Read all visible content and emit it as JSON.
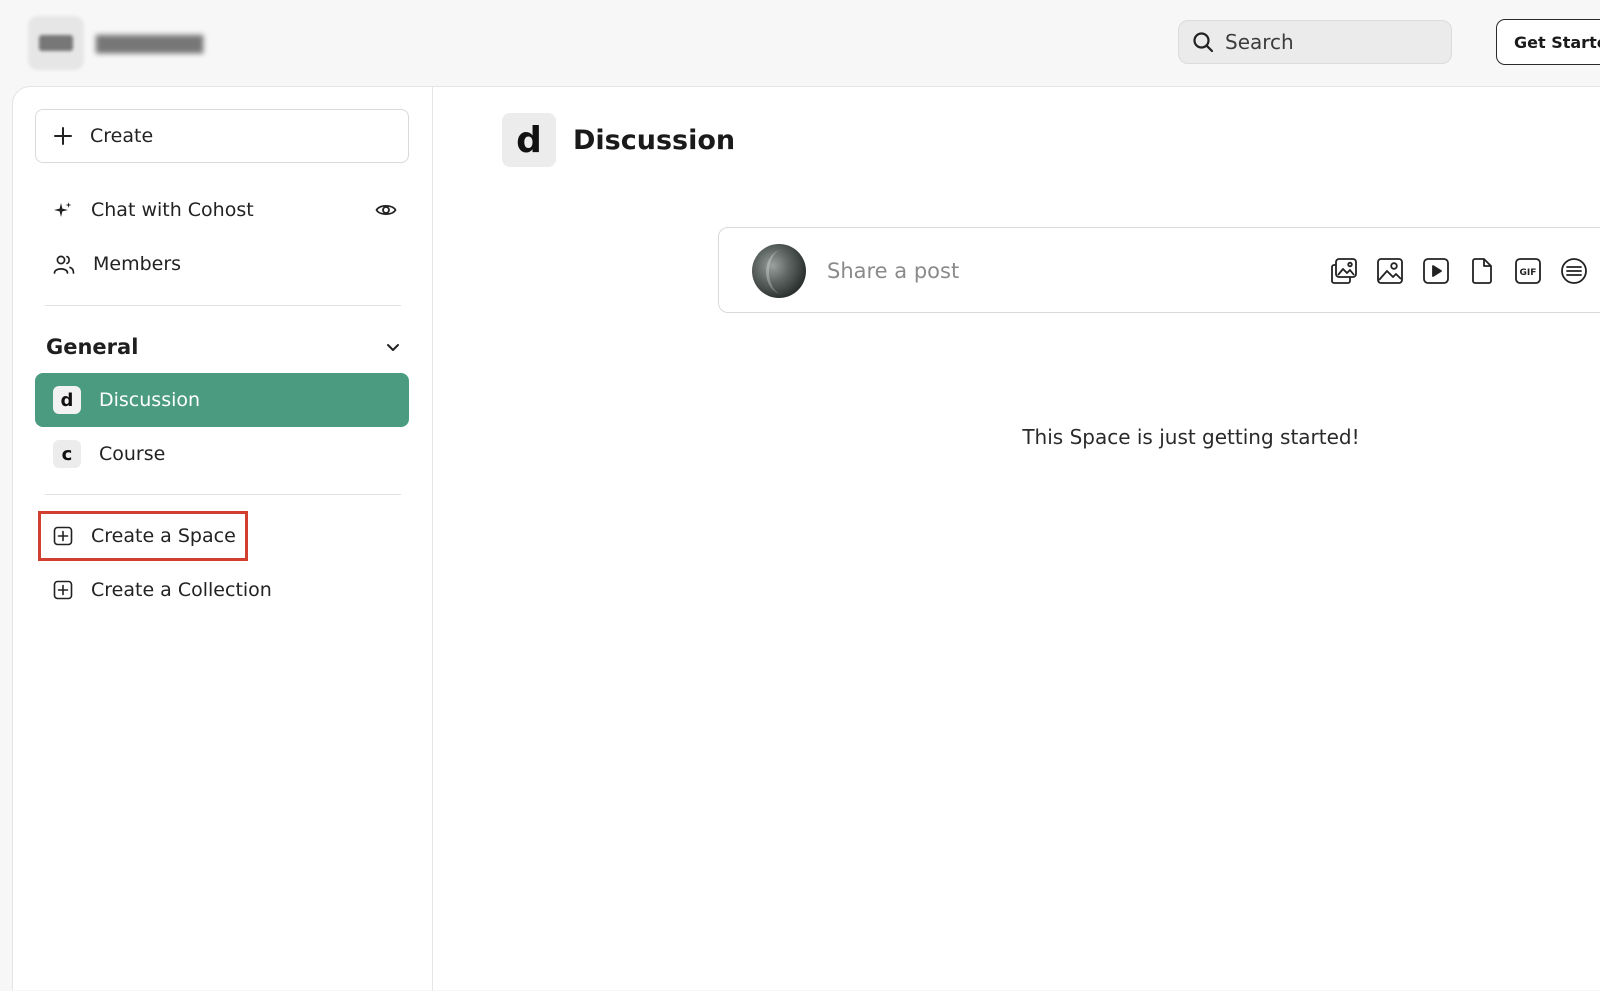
{
  "header": {
    "community_name": "",
    "search_placeholder": "Search",
    "get_started_label": "Get Started"
  },
  "sidebar": {
    "create_label": "Create",
    "items": [
      {
        "label": "Chat with Cohost",
        "icon": "sparkle-icon",
        "trailing_icon": "eye-icon"
      },
      {
        "label": "Members",
        "icon": "members-icon"
      }
    ],
    "section": {
      "title": "General",
      "spaces": [
        {
          "badge": "d",
          "label": "Discussion",
          "active": true
        },
        {
          "badge": "c",
          "label": "Course",
          "active": false
        }
      ]
    },
    "actions": [
      {
        "label": "Create a Space",
        "icon": "plus-square-icon",
        "highlighted": true
      },
      {
        "label": "Create a Collection",
        "icon": "plus-square-icon",
        "highlighted": false
      }
    ]
  },
  "main": {
    "badge": "d",
    "title": "Discussion",
    "composer_placeholder": "Share a post",
    "composer_tools": [
      "gallery-icon",
      "image-icon",
      "video-icon",
      "file-icon",
      "gif-icon",
      "poll-icon"
    ],
    "empty_message": "This Space is just getting started!"
  },
  "colors": {
    "active_space": "#4a9b80",
    "highlight_box": "#d33f2f"
  }
}
